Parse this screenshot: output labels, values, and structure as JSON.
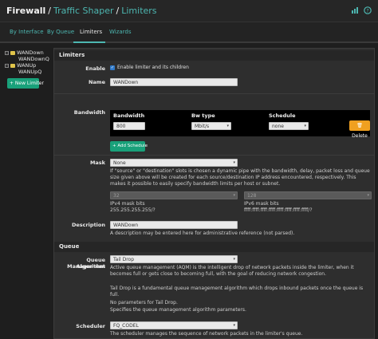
{
  "header": {
    "crumb_firewall": "Firewall",
    "crumb_shaper": "Traffic Shaper",
    "crumb_limiters": "Limiters",
    "sep1": "/",
    "sep2": "/",
    "icons": [
      "chart-icon",
      "help-icon"
    ]
  },
  "tabs": [
    {
      "label": "By Interface",
      "active": false
    },
    {
      "label": "By Queue",
      "active": false
    },
    {
      "label": "Limiters",
      "active": true
    },
    {
      "label": "Wizards",
      "active": false
    }
  ],
  "tree": {
    "items": [
      {
        "label": "WANDown",
        "toggle": "−",
        "folder": true
      },
      {
        "label": "WANDownQ",
        "toggle": "",
        "folder": false
      },
      {
        "label": "WANUp",
        "toggle": "−",
        "folder": true
      },
      {
        "label": "WANUpQ",
        "toggle": "",
        "folder": false
      }
    ],
    "new_limiter_label": "+ New Limiter"
  },
  "limiters": {
    "section_title": "Limiters",
    "enable_label": "Enable",
    "enable_text": "Enable limiter and its children",
    "enable_checked": true,
    "name_label": "Name",
    "name_value": "WANDown",
    "bandwidth_label": "Bandwidth",
    "bw_col_bandwidth": "Bandwidth",
    "bw_col_type": "Bw type",
    "bw_col_schedule": "Schedule",
    "bw_value": "800",
    "bw_type": "Mbit/s",
    "bw_schedule": "none",
    "delete_label": "Delete",
    "add_schedule_label": "+ Add Schedule",
    "mask_label": "Mask",
    "mask_value": "None",
    "mask_help": "If \"source\" or \"destination\" slots is chosen a dynamic pipe with the bandwidth, delay, packet loss and queue size given above will be created for each source/destination IP address encountered, respectively. This makes it possible to easily specify bandwidth limits per host or subnet.",
    "ipv4_bits": "32",
    "ipv4_label": "IPv4 mask bits",
    "ipv4_mask": "255.255.255.255/?",
    "ipv6_bits": "128",
    "ipv6_label": "IPv6 mask bits",
    "ipv6_mask": "ffff:ffff:ffff:ffff:ffff:ffff:ffff:ffff/?",
    "description_label": "Description",
    "description_value": "WANDown",
    "description_help": "A description may be entered here for administrative reference (not parsed)."
  },
  "queue": {
    "section_title": "Queue",
    "qm_label_1": "Queue Management",
    "qm_label_2": "Algorithm",
    "qm_value": "Tail Drop",
    "qm_help": "Active queue management (AQM) is the intelligent drop of network packets inside the limiter, when it becomes full or gets close to becoming full, with the goal of reducing network congestion.",
    "qm_desc": "Tail Drop is a fundamental queue management algorithm which drops inbound packets once the queue is full.",
    "qm_noparams": "No parameters for Tail Drop.",
    "qm_specifies": "Specifies the queue management algorithm parameters.",
    "scheduler_label": "Scheduler",
    "scheduler_value": "FQ_CODEL",
    "scheduler_help": "The scheduler manages the sequence of network packets in the limiter's queue."
  }
}
